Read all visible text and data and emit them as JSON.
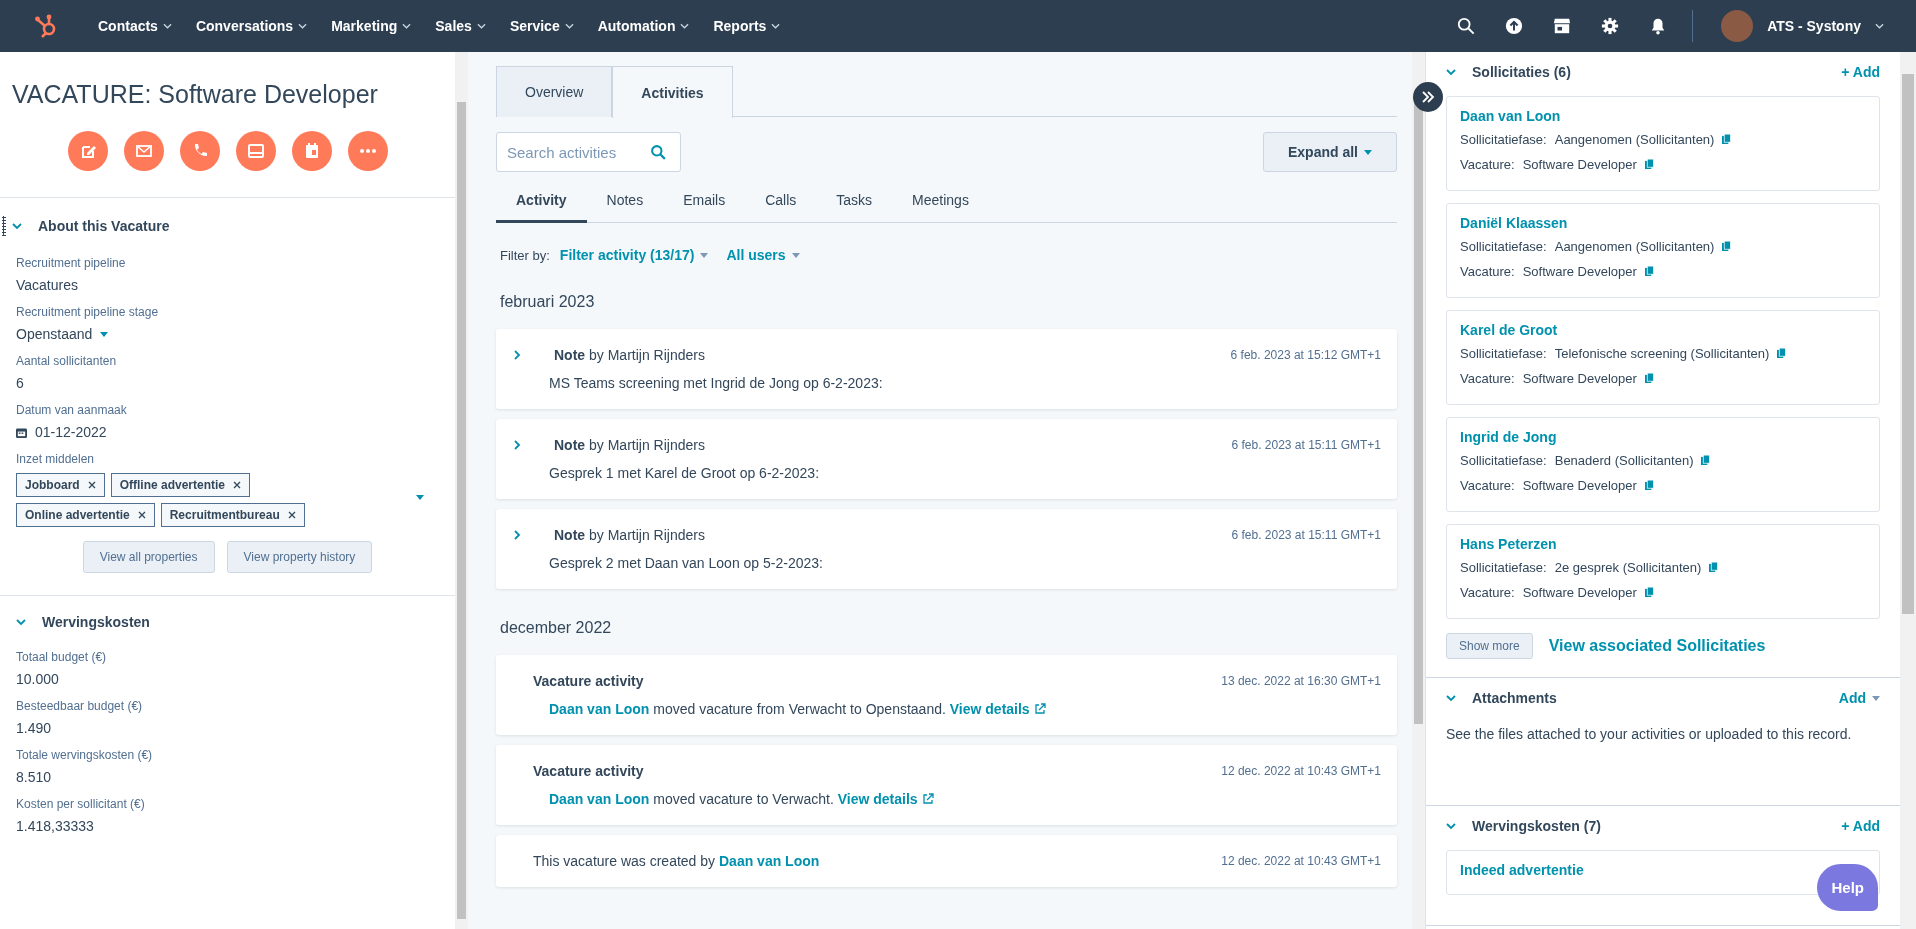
{
  "nav": {
    "menu": [
      {
        "label": "Contacts"
      },
      {
        "label": "Conversations"
      },
      {
        "label": "Marketing"
      },
      {
        "label": "Sales"
      },
      {
        "label": "Service"
      },
      {
        "label": "Automation"
      },
      {
        "label": "Reports"
      }
    ],
    "tools": [
      {
        "kind": "search"
      },
      {
        "kind": "upgrade"
      },
      {
        "kind": "marketplace"
      },
      {
        "kind": "settings"
      },
      {
        "kind": "notifications"
      }
    ],
    "account": "ATS - Systony"
  },
  "record": {
    "title": "VACATURE: Software Developer",
    "actions": [
      {
        "kind": "note"
      },
      {
        "kind": "email"
      },
      {
        "kind": "call"
      },
      {
        "kind": "task"
      },
      {
        "kind": "meeting"
      },
      {
        "kind": "more"
      }
    ],
    "sections": [
      {
        "title": "About this Vacature",
        "expanded": true,
        "properties": [
          {
            "kind": "text",
            "label": "Recruitment pipeline",
            "value": "Vacatures"
          },
          {
            "kind": "dropdown",
            "label": "Recruitment pipeline stage",
            "value": "Openstaand"
          },
          {
            "kind": "text",
            "label": "Aantal sollicitanten",
            "value": "6"
          },
          {
            "kind": "date",
            "label": "Datum van aanmaak",
            "value": "01-12-2022"
          },
          {
            "kind": "tags",
            "label": "Inzet middelen",
            "tags": [
              "Jobboard",
              "Offline advertentie",
              "Online advertentie",
              "Recruitmentbureau"
            ]
          }
        ],
        "buttons": [
          "View all properties",
          "View property history"
        ]
      },
      {
        "title": "Wervingskosten",
        "expanded": true,
        "properties": [
          {
            "kind": "text",
            "label": "Totaal budget (€)",
            "value": "10.000"
          },
          {
            "kind": "text",
            "label": "Besteedbaar budget (€)",
            "value": "1.490"
          },
          {
            "kind": "text",
            "label": "Totale wervingskosten (€)",
            "value": "8.510"
          },
          {
            "kind": "text",
            "label": "Kosten per sollicitant (€)",
            "value": "1.418,33333"
          }
        ]
      }
    ]
  },
  "timeline": {
    "tabs": [
      {
        "label": "Overview",
        "selected": false
      },
      {
        "label": "Activities",
        "selected": true
      }
    ],
    "search": {
      "placeholder": "Search activities"
    },
    "expand_button": "Expand all",
    "subtabs": [
      {
        "label": "Activity",
        "selected": true
      },
      {
        "label": "Notes",
        "selected": false
      },
      {
        "label": "Emails",
        "selected": false
      },
      {
        "label": "Calls",
        "selected": false
      },
      {
        "label": "Tasks",
        "selected": false
      },
      {
        "label": "Meetings",
        "selected": false
      }
    ],
    "filter": {
      "label": "Filter by:",
      "options": [
        "Filter activity (13/17)",
        "All users"
      ]
    },
    "groups": [
      {
        "month": "februari 2023",
        "items": [
          {
            "kind": "note",
            "header": "**Note** by Martijn Rijnders",
            "time": "6 feb. 2023 at 15:12 GMT+1",
            "body": [
              {
                "kind": "text",
                "text": "MS Teams screening met Ingrid de Jong op 6-2-2023:"
              }
            ]
          },
          {
            "kind": "note",
            "header": "**Note** by Martijn Rijnders",
            "time": "6 feb. 2023 at 15:11 GMT+1",
            "body": [
              {
                "kind": "text",
                "text": "Gesprek 1 met Karel de Groot op 6-2-2023:"
              }
            ]
          },
          {
            "kind": "note",
            "header": "**Note** by Martijn Rijnders",
            "time": "6 feb. 2023 at 15:11 GMT+1",
            "body": [
              {
                "kind": "text",
                "text": "Gesprek 2 met Daan van Loon op 5-2-2023:"
              }
            ]
          }
        ]
      },
      {
        "month": "december 2022",
        "items": [
          {
            "kind": "activity",
            "header": "Vacature activity",
            "time": "13 dec. 2022 at 16:30 GMT+1",
            "body": [
              {
                "kind": "link",
                "text": "Daan van Loon"
              },
              {
                "kind": "text",
                "text": "moved vacature from Verwacht to Openstaand."
              },
              {
                "kind": "external_link",
                "text": "View details"
              }
            ]
          },
          {
            "kind": "activity",
            "header": "Vacature activity",
            "time": "12 dec. 2022 at 10:43 GMT+1",
            "body": [
              {
                "kind": "link",
                "text": "Daan van Loon"
              },
              {
                "kind": "text",
                "text": "moved vacature to Verwacht."
              },
              {
                "kind": "external_link",
                "text": "View details"
              }
            ]
          },
          {
            "kind": "created",
            "time": "12 dec. 2022 at 10:43 GMT+1",
            "body": [
              {
                "kind": "text",
                "text": "This vacature was created by"
              },
              {
                "kind": "link",
                "text": "Daan van Loon"
              }
            ]
          }
        ]
      }
    ]
  },
  "sidebar": {
    "cards": [
      {
        "kind": "association",
        "title": "Sollicitaties (6)",
        "expanded": true,
        "add": "+ Add",
        "records": [
          {
            "name": "Daan van Loon",
            "fields": [
              {
                "label": "Sollicitatiefase:",
                "value": "Aangenomen (Sollicitanten)"
              },
              {
                "label": "Vacature:",
                "value": "Software Developer"
              }
            ]
          },
          {
            "name": "Daniël Klaassen",
            "fields": [
              {
                "label": "Sollicitatiefase:",
                "value": "Aangenomen (Sollicitanten)"
              },
              {
                "label": "Vacature:",
                "value": "Software Developer"
              }
            ]
          },
          {
            "name": "Karel de Groot",
            "fields": [
              {
                "label": "Sollicitatiefase:",
                "value": "Telefonische screening (Sollicitanten)"
              },
              {
                "label": "Vacature:",
                "value": "Software Developer"
              }
            ]
          },
          {
            "name": "Ingrid de Jong",
            "fields": [
              {
                "label": "Sollicitatiefase:",
                "value": "Benaderd (Sollicitanten)"
              },
              {
                "label": "Vacature:",
                "value": "Software Developer"
              }
            ]
          },
          {
            "name": "Hans Peterzen",
            "fields": [
              {
                "label": "Sollicitatiefase:",
                "value": "2e gesprek (Sollicitanten)"
              },
              {
                "label": "Vacature:",
                "value": "Software Developer"
              }
            ]
          }
        ],
        "show_more": "Show more",
        "view_all": "View associated Sollicitaties"
      },
      {
        "kind": "attachments",
        "title": "Attachments",
        "expanded": true,
        "add": "Add",
        "text": "See the files attached to your activities or uploaded to this record."
      },
      {
        "kind": "association",
        "title": "Wervingskosten (7)",
        "expanded": true,
        "add": "+ Add",
        "records": [
          {
            "name": "Indeed advertentie"
          }
        ]
      }
    ],
    "help": "Help"
  }
}
